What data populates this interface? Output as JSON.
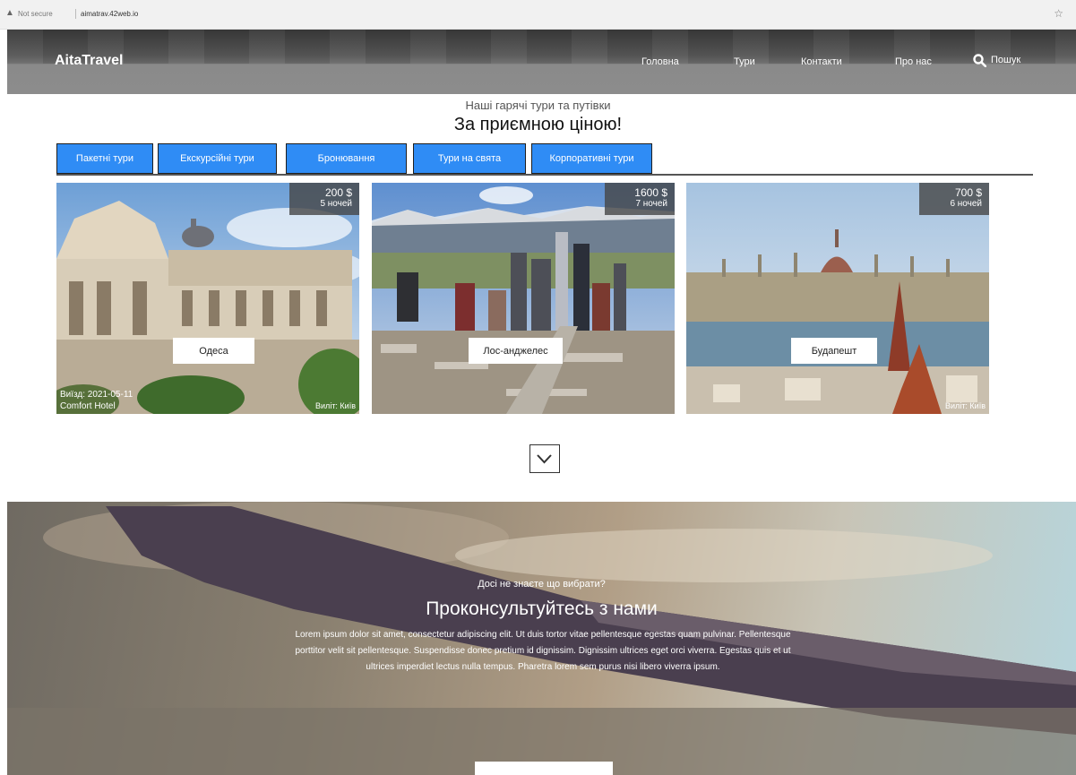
{
  "browser": {
    "security": "Not secure",
    "url": "aimatrav.42web.io",
    "warning_icon": "warning-icon",
    "star_icon": "star-icon"
  },
  "header": {
    "logo": "AitaTravel",
    "nav": [
      "Головна",
      "Тури",
      "Контакти",
      "Про нас"
    ],
    "search_label": "Пошук",
    "search_icon": "search-icon"
  },
  "hot_tours": {
    "subtitle": "Наші гарячі тури та путівки",
    "title": "За приємною ціною!",
    "tabs": [
      "Пакетні тури",
      "Екскурсійні тури",
      "Бронювання",
      "Тури на свята",
      "Корпоративні тури"
    ],
    "cards": [
      {
        "city": "Одеса",
        "price": "200 $",
        "nights": "5 ночей",
        "departure": "Виїзд: 2021-05-11",
        "hotel": "Comfort Hotel",
        "from": "Виліт: Київ"
      },
      {
        "city": "Лос-анджелес",
        "price": "1600 $",
        "nights": "7 ночей"
      },
      {
        "city": "Будапешт",
        "price": "700 $",
        "nights": "6 ночей",
        "from": "Виліт: Київ"
      }
    ],
    "more_icon": "chevron-down-icon"
  },
  "consult": {
    "question": "Досі не знаєте що вибрати?",
    "title": "Проконсультуйтесь з нами",
    "text": "Lorem ipsum dolor sit amet, consectetur adipiscing elit. Ut duis tortor vitae pellentesque egestas quam pulvinar. Pellentesque porttitor velit sit pellentesque. Suspendisse donec pretium id dignissim. Dignissim ultrices eget orci viverra. Egestas quis et ut ultrices imperdiet lectus nulla tempus. Pharetra lorem sem purus nisi libero viverra ipsum."
  },
  "colors": {
    "tab_blue": "#2f8cf5",
    "header_gray": "#8c8c8c"
  }
}
